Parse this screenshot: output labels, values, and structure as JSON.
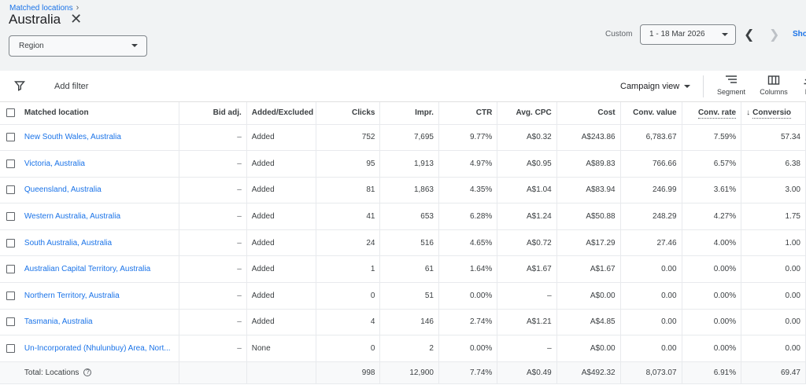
{
  "header": {
    "breadcrumb": "Matched locations",
    "title": "Australia",
    "region_select": "Region",
    "date_range_label": "Custom",
    "date_range": "1 - 18 Mar 2026",
    "show_link": "Sho"
  },
  "toolbar": {
    "add_filter": "Add filter",
    "campaign_view": "Campaign view",
    "segment": "Segment",
    "columns": "Columns",
    "d_label": "D"
  },
  "table": {
    "columns": [
      "Matched location",
      "Bid adj.",
      "Added/Excluded",
      "Clicks",
      "Impr.",
      "CTR",
      "Avg. CPC",
      "Cost",
      "Conv. value",
      "Conv. rate",
      "Conversio"
    ],
    "rows": [
      {
        "location": "New South Wales, Australia",
        "bid": "–",
        "status": "Added",
        "clicks": "752",
        "impr": "7,695",
        "ctr": "9.77%",
        "cpc": "A$0.32",
        "cost": "A$243.86",
        "conv_value": "6,783.67",
        "conv_rate": "7.59%",
        "conversions": "57.34"
      },
      {
        "location": "Victoria, Australia",
        "bid": "–",
        "status": "Added",
        "clicks": "95",
        "impr": "1,913",
        "ctr": "4.97%",
        "cpc": "A$0.95",
        "cost": "A$89.83",
        "conv_value": "766.66",
        "conv_rate": "6.57%",
        "conversions": "6.38"
      },
      {
        "location": "Queensland, Australia",
        "bid": "–",
        "status": "Added",
        "clicks": "81",
        "impr": "1,863",
        "ctr": "4.35%",
        "cpc": "A$1.04",
        "cost": "A$83.94",
        "conv_value": "246.99",
        "conv_rate": "3.61%",
        "conversions": "3.00"
      },
      {
        "location": "Western Australia, Australia",
        "bid": "–",
        "status": "Added",
        "clicks": "41",
        "impr": "653",
        "ctr": "6.28%",
        "cpc": "A$1.24",
        "cost": "A$50.88",
        "conv_value": "248.29",
        "conv_rate": "4.27%",
        "conversions": "1.75"
      },
      {
        "location": "South Australia, Australia",
        "bid": "–",
        "status": "Added",
        "clicks": "24",
        "impr": "516",
        "ctr": "4.65%",
        "cpc": "A$0.72",
        "cost": "A$17.29",
        "conv_value": "27.46",
        "conv_rate": "4.00%",
        "conversions": "1.00"
      },
      {
        "location": "Australian Capital Territory, Australia",
        "bid": "–",
        "status": "Added",
        "clicks": "1",
        "impr": "61",
        "ctr": "1.64%",
        "cpc": "A$1.67",
        "cost": "A$1.67",
        "conv_value": "0.00",
        "conv_rate": "0.00%",
        "conversions": "0.00"
      },
      {
        "location": "Northern Territory, Australia",
        "bid": "–",
        "status": "Added",
        "clicks": "0",
        "impr": "51",
        "ctr": "0.00%",
        "cpc": "–",
        "cost": "A$0.00",
        "conv_value": "0.00",
        "conv_rate": "0.00%",
        "conversions": "0.00"
      },
      {
        "location": "Tasmania, Australia",
        "bid": "–",
        "status": "Added",
        "clicks": "4",
        "impr": "146",
        "ctr": "2.74%",
        "cpc": "A$1.21",
        "cost": "A$4.85",
        "conv_value": "0.00",
        "conv_rate": "0.00%",
        "conversions": "0.00"
      },
      {
        "location": "Un-Incorporated (Nhulunbuy) Area, Nort...",
        "bid": "–",
        "status": "None",
        "clicks": "0",
        "impr": "2",
        "ctr": "0.00%",
        "cpc": "–",
        "cost": "A$0.00",
        "conv_value": "0.00",
        "conv_rate": "0.00%",
        "conversions": "0.00"
      }
    ],
    "total": {
      "label": "Total: Locations",
      "clicks": "998",
      "impr": "12,900",
      "ctr": "7.74%",
      "cpc": "A$0.49",
      "cost": "A$492.32",
      "conv_value": "8,073.07",
      "conv_rate": "6.91%",
      "conversions": "69.47"
    }
  }
}
